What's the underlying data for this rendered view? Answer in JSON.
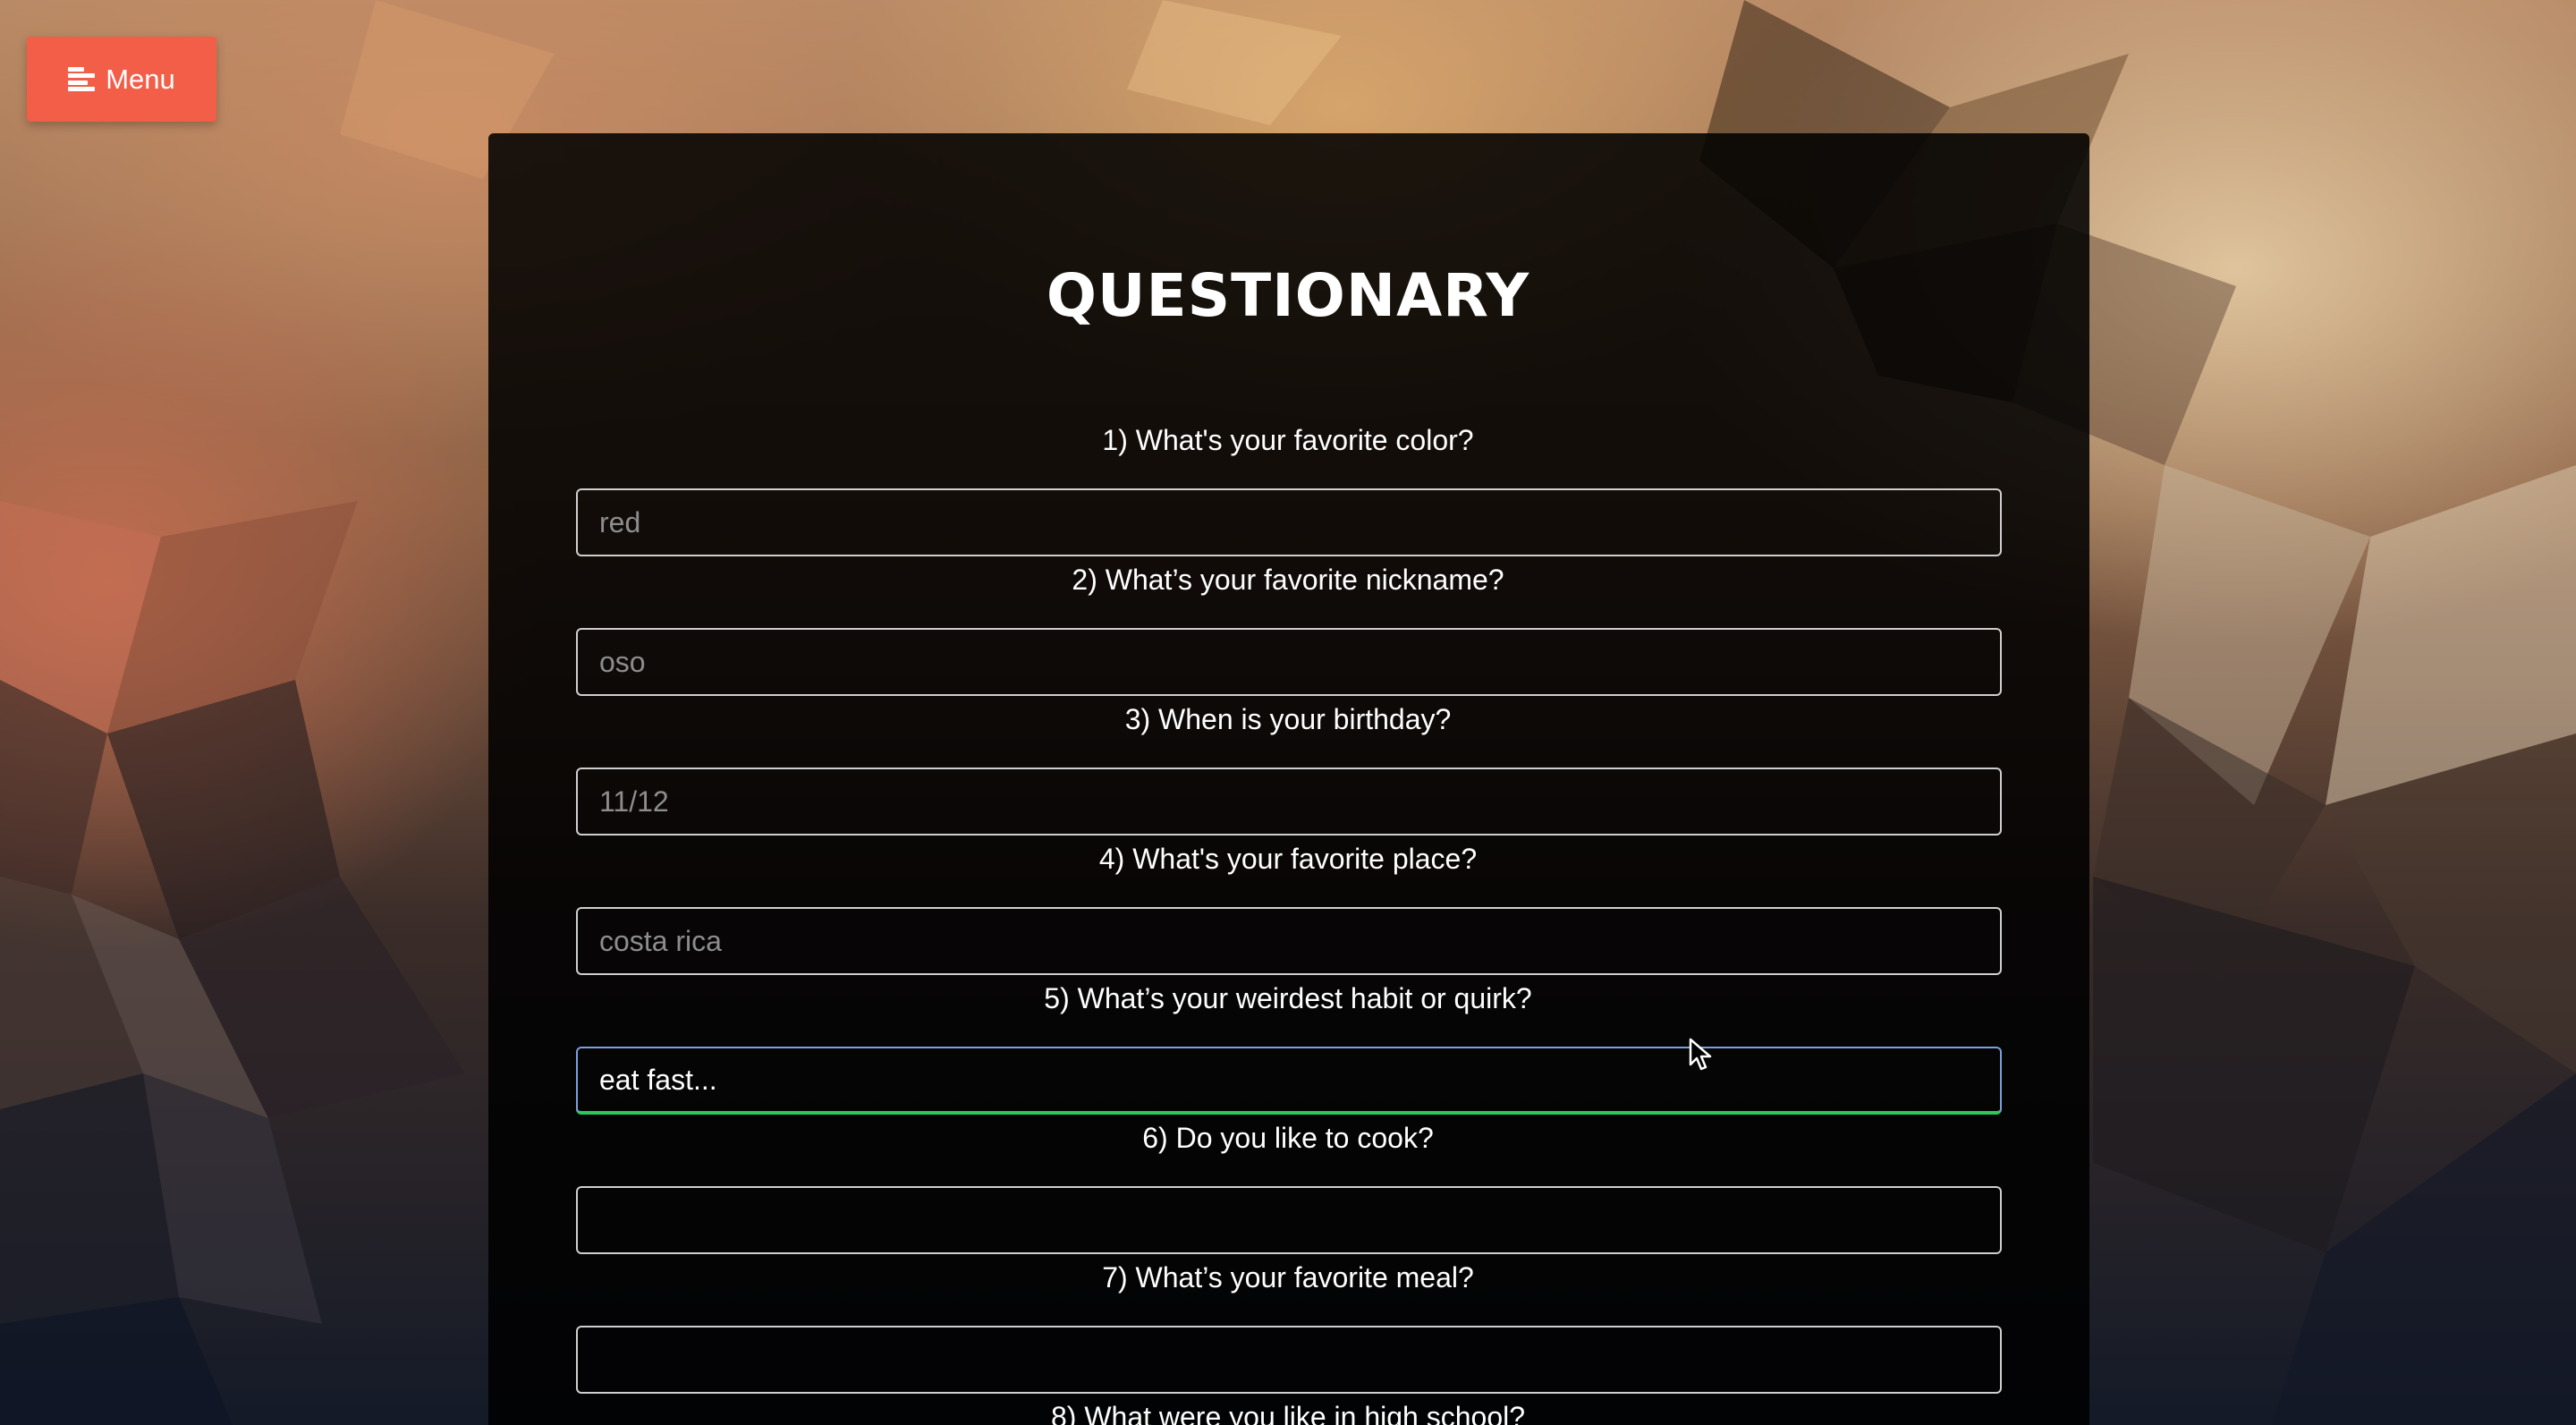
{
  "menu": {
    "label": "Menu",
    "icon": "hamburger-icon",
    "color": "#f25e47"
  },
  "title": "QUESTIONARY",
  "questions": [
    {
      "label": "1) What's your favorite color?",
      "placeholder": "red",
      "value": ""
    },
    {
      "label": "2) What’s your favorite nickname?",
      "placeholder": "oso",
      "value": ""
    },
    {
      "label": "3) When is your birthday?",
      "placeholder": "11/12",
      "value": ""
    },
    {
      "label": "4) What's your favorite place?",
      "placeholder": "costa rica",
      "value": ""
    },
    {
      "label": "5) What’s your weirdest habit or quirk?",
      "placeholder": "",
      "value": "eat fast..."
    },
    {
      "label": "6) Do you like to cook?",
      "placeholder": "",
      "value": ""
    },
    {
      "label": "7) What’s your favorite meal?",
      "placeholder": "",
      "value": ""
    },
    {
      "label": "8) What were you like in high school?",
      "placeholder": "",
      "value": ""
    }
  ],
  "focused_field_color": "#2ec85a"
}
